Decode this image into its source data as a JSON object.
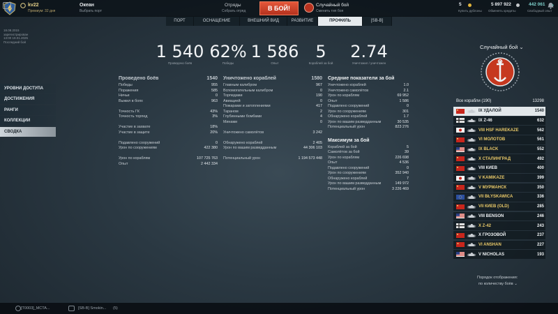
{
  "header": {
    "nickname": "kv22",
    "premium": "Премиум: 32 дня",
    "port": "Океан",
    "port_sub": "Выбрать порт",
    "squads": "Отряды",
    "squads_sub": "Собрать отряд",
    "battle_button": "В БОЙ!",
    "mode": "Случайный бой",
    "mode_sub": "Сменить тип боя",
    "doubloons": "5",
    "doubloons_sub": "Купить дублоны",
    "credits": "5 897 922",
    "credits_sub": "Обменять кредиты",
    "xp": "442 061",
    "xp_sub": "Свободный опыт"
  },
  "nav": {
    "tabs": [
      "ПОРТ",
      "ОСНАЩЕНИЕ",
      "ВНЕШНИЙ ВИД",
      "РАЗВИТИЕ",
      "ПРОФИЛЬ",
      "[SB-B]"
    ]
  },
  "left_info": {
    "line1": "18.08.2015",
    "line2": "зарегистрирован",
    "line3": "13:00  19.01.2025",
    "line4": "Последний бой"
  },
  "sidebar": {
    "items": [
      "УРОВНИ ДОСТУПА",
      "ДОСТИЖЕНИЯ",
      "РАНГИ",
      "КОЛЛЕКЦИИ",
      "СВОДКА"
    ]
  },
  "summary": {
    "battles": "1 540",
    "battles_label": "Проведено боёв",
    "winrate": "62%",
    "winrate_label": "Победы",
    "avg_xp": "1 586",
    "avg_xp_label": "Опыт",
    "kills": "5",
    "kills_label": "Кораблей за бой",
    "kd": "2.74",
    "kd_label": "Уничтожил / уничтожен"
  },
  "col1": {
    "title": "Проведено боёв",
    "title_value": "1540",
    "rows": [
      [
        "Победы",
        "955"
      ],
      [
        "Поражения",
        "585"
      ],
      [
        "Ничьи",
        "0"
      ],
      [
        "Выжил в боях",
        "963"
      ],
      [
        "",
        ""
      ],
      [
        "Точность ГК",
        "43%"
      ],
      [
        "Точность торпед",
        "3%"
      ],
      [
        "",
        ""
      ],
      [
        "Участие в захвате",
        "18%"
      ],
      [
        "Участие в защите",
        "20%"
      ],
      [
        "",
        ""
      ],
      [
        "Подавлено сооружений",
        "0"
      ],
      [
        "Урон по сооружениям",
        "422 380"
      ],
      [
        "",
        ""
      ],
      [
        "Урон по кораблям",
        "107 725 763"
      ],
      [
        "Опыт",
        "2 442 334"
      ]
    ]
  },
  "col2": {
    "title": "Уничтожено кораблей",
    "title_value": "1580",
    "rows": [
      [
        "Главным калибром",
        "967"
      ],
      [
        "Вспомогательным калибром",
        "0"
      ],
      [
        "Торпедами",
        "190"
      ],
      [
        "Авиацией",
        "0"
      ],
      [
        "Пожарами и затоплениями",
        "417"
      ],
      [
        "Тараном",
        "2"
      ],
      [
        "Глубинными бомбами",
        "4"
      ],
      [
        "Минами",
        "0"
      ],
      [
        "",
        ""
      ],
      [
        "Уничтожено самолётов",
        "3 242"
      ],
      [
        "",
        ""
      ],
      [
        "Обнаружено кораблей",
        "2 405"
      ],
      [
        "Урон по вашим разведданным",
        "44 306 103"
      ],
      [
        "",
        ""
      ],
      [
        "Потенциальный урон",
        "1 194 573 448"
      ]
    ]
  },
  "col3": {
    "title": "Средние показатели за бой",
    "rows": [
      [
        "Уничтожено кораблей",
        "1.0"
      ],
      [
        "Уничтожено самолётов",
        "2.1"
      ],
      [
        "Урон по кораблям",
        "69 952"
      ],
      [
        "Опыт",
        "1 586"
      ],
      [
        "Подавлено сооружений",
        "0"
      ],
      [
        "Урон по сооружениям",
        "301"
      ],
      [
        "Обнаружено кораблей",
        "1.7"
      ],
      [
        "Урон по вашим разведданным",
        "30 535"
      ],
      [
        "Потенциальный урон",
        "823 276"
      ]
    ],
    "title2": "Максимум за бой",
    "rows2": [
      [
        "Кораблей за бой",
        "5"
      ],
      [
        "Самолётов за бой",
        "39"
      ],
      [
        "Урон по кораблям",
        "226 698"
      ],
      [
        "Опыт",
        "4 536"
      ],
      [
        "Подавлено сооружений",
        "0"
      ],
      [
        "Урон по сооружениям",
        "352 940"
      ],
      [
        "Обнаружено кораблей",
        "7"
      ],
      [
        "Урон по вашим разведданным",
        "149 972"
      ],
      [
        "Потенциальный урон",
        "3 226 469"
      ]
    ]
  },
  "right": {
    "mode_select": "Случайный бой",
    "all_ships": "Все корабли (190)",
    "all_ships_value": "13298",
    "ships": [
      {
        "name": "IX УДАЛОЙ",
        "count": "1540",
        "flag": "ussr",
        "white": false
      },
      {
        "name": "IX Z-46",
        "count": "632",
        "flag": "germany",
        "white": true
      },
      {
        "name": "VIII HSF HAREKAZE",
        "count": "562",
        "flag": "japan",
        "white": false
      },
      {
        "name": "VI МОЛОТОВ",
        "count": "561",
        "flag": "ussr",
        "white": false
      },
      {
        "name": "IX BLACK",
        "count": "552",
        "flag": "usa",
        "white": false
      },
      {
        "name": "X СТАЛИНГРАД",
        "count": "492",
        "flag": "ussr",
        "white": false
      },
      {
        "name": "VIII КИЕВ",
        "count": "400",
        "flag": "ussr",
        "white": true
      },
      {
        "name": "V KAMIKAZE",
        "count": "399",
        "flag": "japan",
        "white": false
      },
      {
        "name": "V МУРМАНСК",
        "count": "350",
        "flag": "ussr",
        "white": false
      },
      {
        "name": "VII BŁYSKAWICA",
        "count": "336",
        "flag": "europe",
        "white": false
      },
      {
        "name": "VII КИЕВ (OLD)",
        "count": "285",
        "flag": "ussr",
        "white": false
      },
      {
        "name": "VIII BENSON",
        "count": "246",
        "flag": "usa",
        "white": true
      },
      {
        "name": "X Z-42",
        "count": "243",
        "flag": "germany",
        "white": false
      },
      {
        "name": "X ГРОЗОВОЙ",
        "count": "237",
        "flag": "ussr",
        "white": true
      },
      {
        "name": "VI ANSHAN",
        "count": "227",
        "flag": "china",
        "white": false
      },
      {
        "name": "V NICHOLAS",
        "count": "193",
        "flag": "usa",
        "white": true
      }
    ],
    "order_label": "Порядок отображения:",
    "order_value": "по количеству боёв"
  },
  "bottom": {
    "chat1": "[T0003]_MCTA...",
    "chat2": "[SB-B] Smokin...",
    "chat2_count": "(5)"
  },
  "colors": {
    "accent_red": "#c6381f",
    "gold": "#e8c868",
    "active_tab": "#e6eaed"
  }
}
